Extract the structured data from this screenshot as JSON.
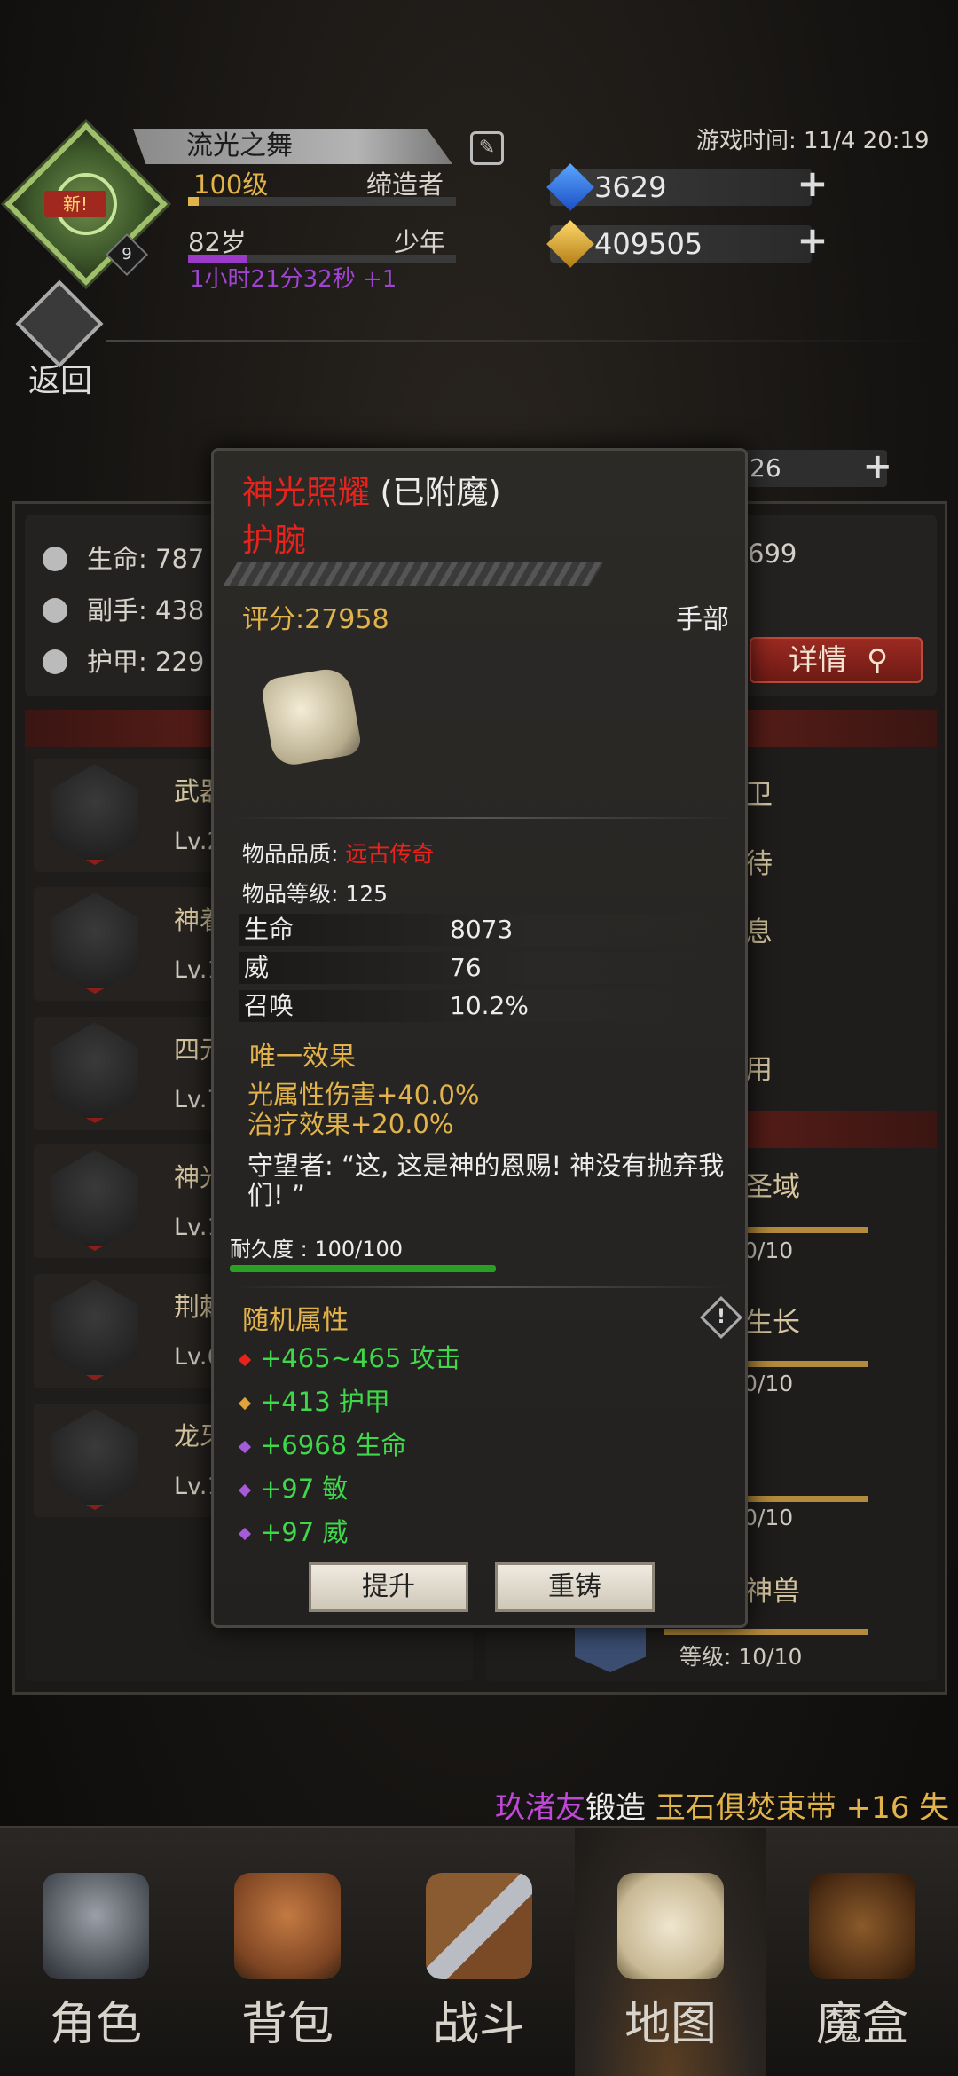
{
  "header": {
    "player_name": "流光之舞",
    "level": "100级",
    "class": "缔造者",
    "age": "82岁",
    "age_stage": "少年",
    "timer": "1小时21分32秒 +1",
    "new_badge": "新!",
    "avatar_level": "9",
    "game_time": "游戏时间: 11/4 20:19",
    "gems": "3629",
    "gold": "409505",
    "back_label": "返回",
    "partial_resource": "26"
  },
  "stats": {
    "life": "生命: 787",
    "offhand": "副手: 438",
    "armor": "护甲: 229",
    "right_value": "699",
    "detail_btn": "详情"
  },
  "equipment": [
    {
      "name": "武器",
      "lv": "Lv.2"
    },
    {
      "name": "神着",
      "lv": "Lv.1"
    },
    {
      "name": "四元",
      "lv": "Lv.7"
    },
    {
      "name": "神光",
      "lv": "Lv.1"
    },
    {
      "name": "荆棘",
      "lv": "Lv.6"
    },
    {
      "name": "龙牙",
      "lv": "Lv.1"
    }
  ],
  "right_col": {
    "items": [
      "卫",
      "待",
      "息",
      "用"
    ],
    "skills": [
      {
        "name": "圣域",
        "progress": "0/10"
      },
      {
        "name": "生长",
        "progress": "0/10"
      },
      {
        "name": "",
        "progress": "0/10"
      },
      {
        "name": "神兽",
        "progress": "等级: 10/10"
      }
    ]
  },
  "popup": {
    "item_name": "神光照耀",
    "enchant_tag": " (已附魔)",
    "item_type": "护腕",
    "score": "评分:27958",
    "slot": "手部",
    "quality_label": "物品品质: ",
    "quality_value": "远古传奇",
    "item_level": "物品等级: 125",
    "base_stats": [
      {
        "k": "生命",
        "v": "8073"
      },
      {
        "k": "威",
        "v": "76"
      },
      {
        "k": "召唤",
        "v": "10.2%"
      }
    ],
    "unique_title": "唯一效果",
    "unique_effect_1": "光属性伤害+40.0%",
    "unique_effect_2": "治疗效果+20.0%",
    "quote": "守望者: “这, 这是神的恩赐! 神没有抛弃我们! ”",
    "durability": "耐久度 : 100/100",
    "durability_fraction": 1.0,
    "random_title": "随机属性",
    "random_stats": [
      {
        "text": "+465~465 攻击",
        "color": "#e8231c"
      },
      {
        "text": "+413 护甲",
        "color": "#e1a23a"
      },
      {
        "text": "+6968 生命",
        "color": "#a55ad8"
      },
      {
        "text": "+97 敏",
        "color": "#a55ad8"
      },
      {
        "text": "+97 威",
        "color": "#a55ad8"
      }
    ],
    "upgrade_btn": "提升",
    "reforge_btn": "重铸"
  },
  "ticker": {
    "player": "玖渚友",
    "action": "锻造 ",
    "item": "玉石俱焚束带",
    "suffix": " +16 失"
  },
  "nav": [
    {
      "label": "角色",
      "icon": "helmet-icon"
    },
    {
      "label": "背包",
      "icon": "backpack-icon"
    },
    {
      "label": "战斗",
      "icon": "sword-shield-icon"
    },
    {
      "label": "地图",
      "icon": "scroll-map-icon"
    },
    {
      "label": "魔盒",
      "icon": "magic-box-icon"
    }
  ],
  "colors": {
    "rarity_red": "#e8231c",
    "gold_text": "#e1b34a",
    "green_stat": "#3fd84a"
  }
}
